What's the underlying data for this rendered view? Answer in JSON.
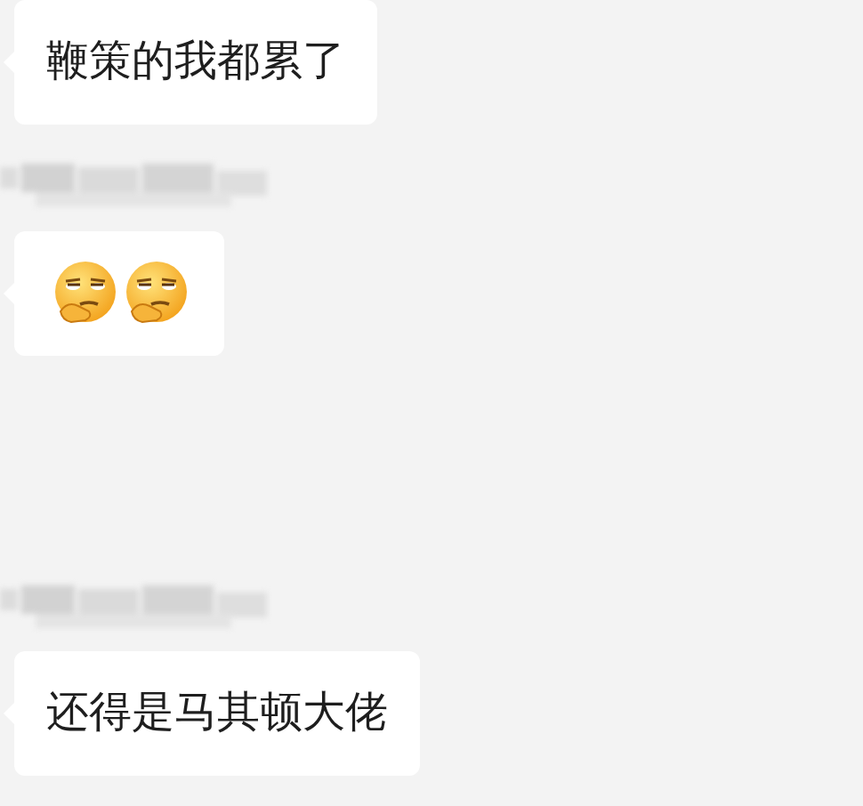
{
  "messages": [
    {
      "kind": "text",
      "text": "鞭策的我都累了"
    },
    {
      "kind": "blurred_name"
    },
    {
      "kind": "emoji_row",
      "items": [
        {
          "kind": "thinking_emoji"
        },
        {
          "kind": "thinking_emoji"
        }
      ]
    },
    {
      "kind": "blurred_name"
    },
    {
      "kind": "text",
      "text": "还得是马其顿大佬"
    }
  ]
}
